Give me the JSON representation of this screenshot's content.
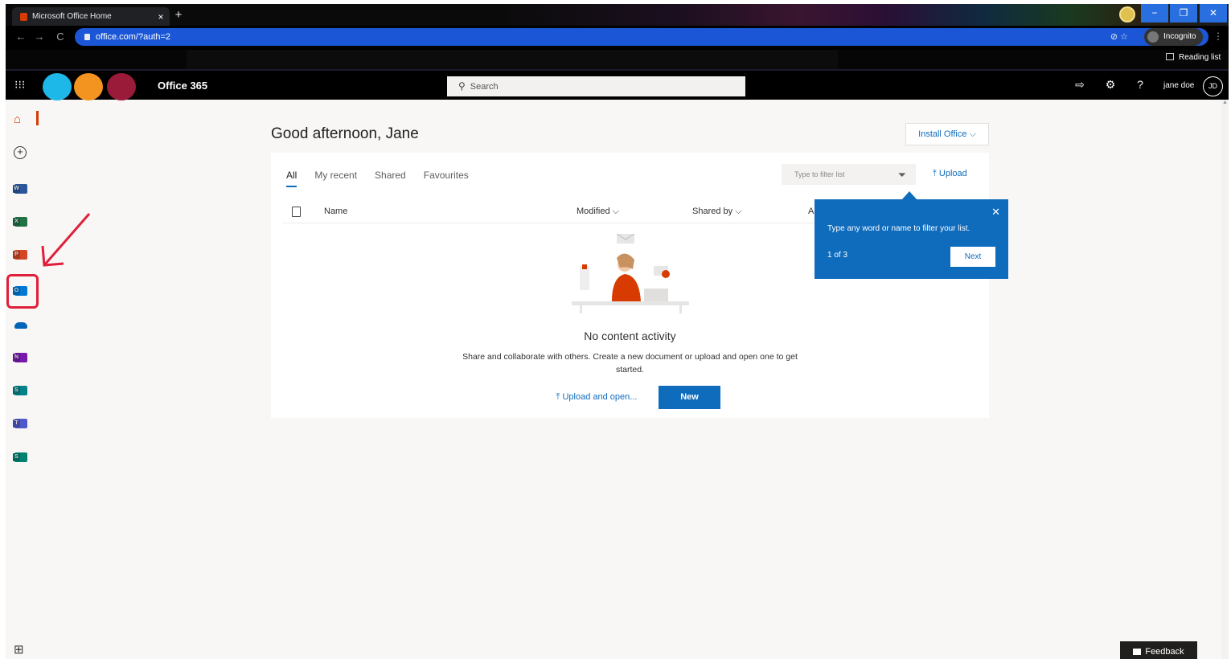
{
  "browser": {
    "tab_title": "Microsoft Office Home",
    "tab_close": "×",
    "new_tab": "+",
    "url": "office.com/?auth=2",
    "incognito_label": "Incognito",
    "reading_list": "Reading list",
    "window_controls": {
      "minimize": "−",
      "maximize": "❐",
      "close": "✕"
    },
    "nav": {
      "back": "←",
      "forward": "→",
      "reload": "C"
    },
    "kebab": "⋮",
    "omni_icons": "⊘  ☆"
  },
  "header": {
    "app_launcher_glyph": "⁝⁝⁝",
    "brand": "Office 365",
    "search_placeholder": "Search",
    "search_icon_glyph": "⚲",
    "icons": {
      "feedback": "⇨",
      "settings": "⚙",
      "help": "?"
    },
    "user_name": "jane doe",
    "user_initials": "JD"
  },
  "rail": {
    "items": [
      {
        "name": "word",
        "letter": "W",
        "color": "#2b579a"
      },
      {
        "name": "excel",
        "letter": "X",
        "color": "#217346"
      },
      {
        "name": "powerpoint",
        "letter": "P",
        "color": "#d24726"
      },
      {
        "name": "outlook",
        "letter": "O",
        "color": "#0078d4"
      },
      {
        "name": "onedrive",
        "letter": "",
        "color": "#0364b8"
      },
      {
        "name": "onenote",
        "letter": "N",
        "color": "#7719aa"
      },
      {
        "name": "sharepoint",
        "letter": "S",
        "color": "#038387"
      },
      {
        "name": "teams",
        "letter": "T",
        "color": "#5059c9"
      },
      {
        "name": "sway",
        "letter": "S",
        "color": "#008272"
      }
    ],
    "all_apps_glyph": "⊞"
  },
  "main": {
    "greeting": "Good afternoon, Jane",
    "install_office": "Install Office ⌵",
    "tabs": [
      "All",
      "My recent",
      "Shared",
      "Favourites"
    ],
    "filter_placeholder": "Type to filter list",
    "upload_label": "⤒  Upload",
    "columns": {
      "name": "Name",
      "modified": "Modified ⌵",
      "shared_by": "Shared by ⌵",
      "activity": "A"
    },
    "empty_title": "No content activity",
    "empty_desc": "Share and collaborate with others. Create a new document or upload and open one to get started.",
    "upload_open": "⤒  Upload and open...",
    "new_label": "New"
  },
  "callout": {
    "message": "Type any word or name to filter your list.",
    "count": "1 of 3",
    "next": "Next",
    "close": "✕"
  },
  "feedback": "Feedback",
  "colors": {
    "accent": "#0f6cbd",
    "annotation": "#e0203a",
    "header_bg": "#000000",
    "omnibox": "#1a56d6"
  }
}
